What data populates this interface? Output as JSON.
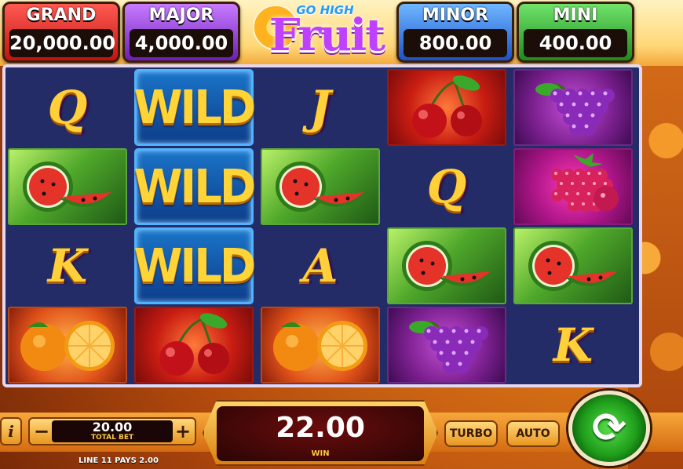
{
  "jackpots": {
    "grand": {
      "label": "GRAND",
      "value": "20,000.00"
    },
    "major": {
      "label": "MAJOR",
      "value": "4,000.00"
    },
    "minor": {
      "label": "MINOR",
      "value": "800.00"
    },
    "mini": {
      "label": "MINI",
      "value": "400.00"
    }
  },
  "logo": {
    "small": "GO HIGH",
    "big": "Fruit"
  },
  "reels": [
    [
      {
        "symbol": "Q",
        "kind": "letter"
      },
      {
        "symbol": "watermelon",
        "kind": "fruit",
        "bg": "green"
      },
      {
        "symbol": "K",
        "kind": "letter"
      },
      {
        "symbol": "orange",
        "kind": "fruit",
        "bg": "orange"
      }
    ],
    [
      {
        "symbol": "WILD",
        "kind": "wild"
      },
      {
        "symbol": "WILD",
        "kind": "wild"
      },
      {
        "symbol": "WILD",
        "kind": "wild"
      },
      {
        "symbol": "cherry",
        "kind": "fruit",
        "bg": "red"
      }
    ],
    [
      {
        "symbol": "J",
        "kind": "letter"
      },
      {
        "symbol": "watermelon",
        "kind": "fruit",
        "bg": "green"
      },
      {
        "symbol": "A",
        "kind": "letter"
      },
      {
        "symbol": "orange",
        "kind": "fruit",
        "bg": "orange"
      }
    ],
    [
      {
        "symbol": "cherry",
        "kind": "fruit",
        "bg": "red"
      },
      {
        "symbol": "Q",
        "kind": "letter"
      },
      {
        "symbol": "watermelon",
        "kind": "fruit",
        "bg": "green"
      },
      {
        "symbol": "grapes",
        "kind": "fruit",
        "bg": "grape"
      }
    ],
    [
      {
        "symbol": "grapes",
        "kind": "fruit",
        "bg": "grape"
      },
      {
        "symbol": "raspberry",
        "kind": "fruit",
        "bg": "purple"
      },
      {
        "symbol": "watermelon",
        "kind": "fruit",
        "bg": "green"
      },
      {
        "symbol": "K",
        "kind": "letter"
      }
    ]
  ],
  "controls": {
    "info_label": "i",
    "minus_label": "−",
    "plus_label": "+",
    "bet_value": "20.00",
    "bet_label": "TOTAL BET",
    "win_value": "22.00",
    "win_label": "WIN",
    "line_pays": "LINE 11 PAYS 2.00",
    "turbo_label": "TURBO",
    "auto_label": "AUTO",
    "spin_icon": "spin-arrows-icon"
  }
}
